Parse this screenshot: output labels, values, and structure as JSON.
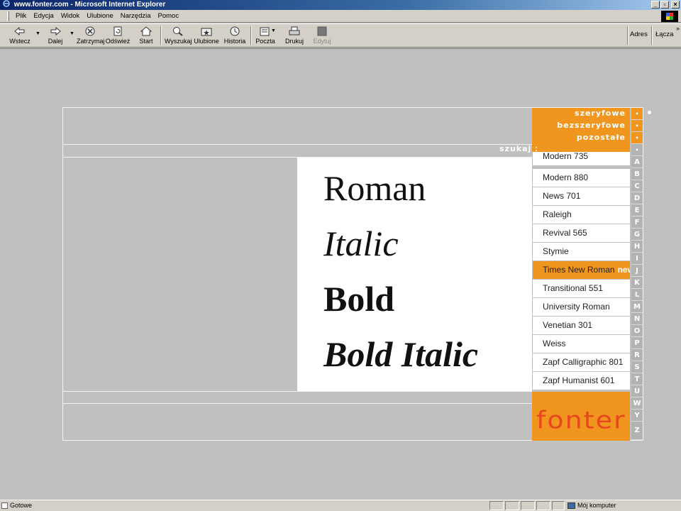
{
  "window": {
    "title": "www.fonter.com - Microsoft Internet Explorer",
    "controls": [
      "_",
      "▫",
      "×"
    ]
  },
  "menubar": {
    "items": [
      "Plik",
      "Edycja",
      "Widok",
      "Ulubione",
      "Narzędzia",
      "Pomoc"
    ]
  },
  "toolbar": {
    "back": "Wstecz",
    "forward": "Dalej",
    "stop": "Zatrzymaj",
    "refresh": "Odśwież",
    "home": "Start",
    "search": "Wyszukaj",
    "favorites": "Ulubione",
    "history": "Historia",
    "mail": "Poczta",
    "print": "Drukuj",
    "edit": "Edytuj",
    "address_label": "Adres",
    "links_label": "Łącza",
    "more": "»"
  },
  "page": {
    "categories": [
      "szeryfowe",
      "bezszeryfowe",
      "pozostałe"
    ],
    "search_label": "szukaj",
    "search_colon": ":",
    "samples": {
      "roman": "Roman",
      "italic": "Italic",
      "bold": "Bold",
      "bold_italic": "Bold Italic"
    },
    "fonts": [
      {
        "name": "Modern 735",
        "active": false
      },
      {
        "name": "Modern 880",
        "active": false
      },
      {
        "name": "News 701",
        "active": false
      },
      {
        "name": "Raleigh",
        "active": false
      },
      {
        "name": "Revival 565",
        "active": false
      },
      {
        "name": "Stymie",
        "active": false
      },
      {
        "name": "Times New Roman",
        "active": true,
        "badge": "new"
      },
      {
        "name": "Transitional 551",
        "active": false
      },
      {
        "name": "University Roman",
        "active": false
      },
      {
        "name": "Venetian 301",
        "active": false
      },
      {
        "name": "Weiss",
        "active": false
      },
      {
        "name": "Zapf Calligraphic 801",
        "active": false
      },
      {
        "name": "Zapf Humanist 601",
        "active": false
      }
    ],
    "alphabet": [
      "•",
      "•",
      "•",
      "•",
      "A",
      "B",
      "C",
      "D",
      "E",
      "F",
      "G",
      "H",
      "I",
      "J",
      "K",
      "L",
      "M",
      "N",
      "O",
      "P",
      "R",
      "S",
      "T",
      "U",
      "W",
      "Y",
      "Z"
    ],
    "logo": "fonter",
    "accent_color": "#f0961e"
  },
  "statusbar": {
    "left": "Gotowe",
    "right": "Mój komputer"
  }
}
